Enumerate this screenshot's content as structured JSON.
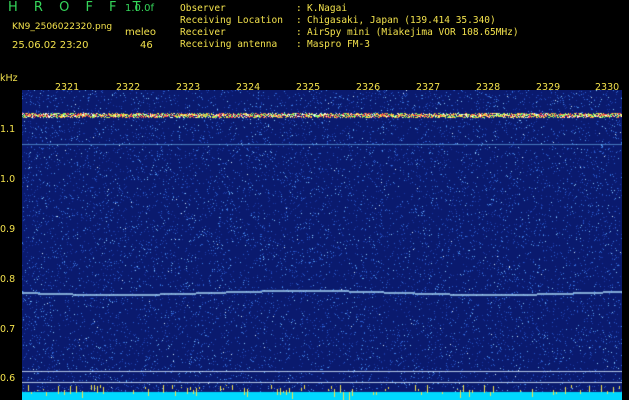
{
  "header": {
    "app_title": "H R O F F T",
    "version": "1.0.0f",
    "filename": "KN9_2506022320.png",
    "station": "meleo",
    "timestamp": "25.06.02 23:20",
    "count": "46",
    "info": [
      {
        "label": "Observer",
        "value": "K.Nagai"
      },
      {
        "label": "Receiving Location",
        "value": "Chigasaki, Japan (139.414 35.340)"
      },
      {
        "label": "Receiver",
        "value": "AirSpy mini (Miakejima VOR 108.65MHz)"
      },
      {
        "label": "Receiving antenna",
        "value": "Maspro FM-3"
      }
    ],
    "separator": ":"
  },
  "spectrogram": {
    "y_unit": "kHz",
    "y_labels": [
      "1.1",
      "1.0",
      "0.9",
      "0.8",
      "0.7",
      "0.6"
    ],
    "minute_labels": [
      "2321",
      "2322",
      "2323",
      "2324",
      "2325",
      "2326",
      "2327",
      "2328",
      "2329",
      "2330"
    ],
    "colors": {
      "background": "#0a1a6e",
      "noise": "#2a5fd0",
      "signal": "#ffffff",
      "baseline": "#00d8ff",
      "text": "#f2e14c"
    }
  }
}
